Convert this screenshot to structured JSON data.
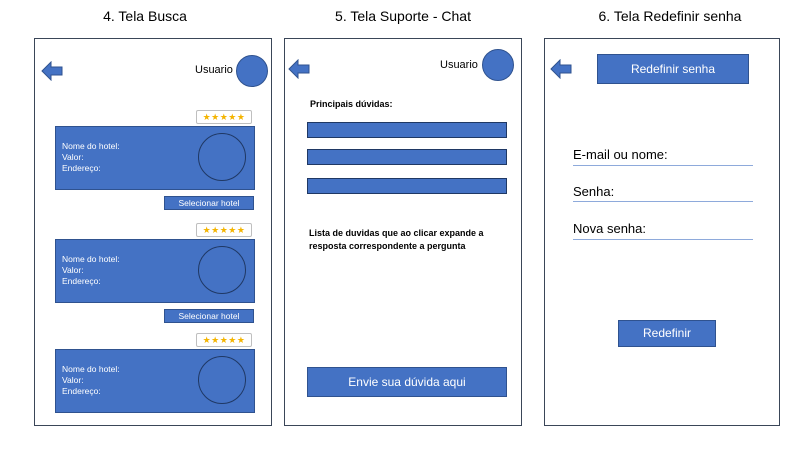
{
  "screens": [
    {
      "title": "4. Tela Busca"
    },
    {
      "title": "5. Tela Suporte - Chat"
    },
    {
      "title": "6. Tela Redefinir senha"
    }
  ],
  "busca": {
    "user_label": "Usuario",
    "stars": "★★★★★",
    "hotels": [
      {
        "line1": "Nome do hotel:",
        "line2": "Valor:",
        "line3": "Endereço:",
        "select_label": "Selecionar hotel"
      },
      {
        "line1": "Nome do hotel:",
        "line2": "Valor:",
        "line3": "Endereço:",
        "select_label": "Selecionar hotel"
      },
      {
        "line1": "Nome do hotel:",
        "line2": "Valor:",
        "line3": "Endereço:"
      }
    ]
  },
  "suporte": {
    "user_label": "Usuario",
    "faq_heading": "Principais dúvidas:",
    "faq_description": "Lista de duvidas que ao clicar expande a resposta correspondente a pergunta",
    "send_button": "Envie sua dúvida aqui"
  },
  "redefinir": {
    "header_button": "Redefinir senha",
    "fields": [
      {
        "label": "E-mail ou nome:"
      },
      {
        "label": "Senha:"
      },
      {
        "label": "Nova senha:"
      }
    ],
    "submit_button": "Redefinir"
  },
  "colors": {
    "primary": "#4472c4",
    "border": "#2f528f",
    "star": "#f4b400"
  }
}
